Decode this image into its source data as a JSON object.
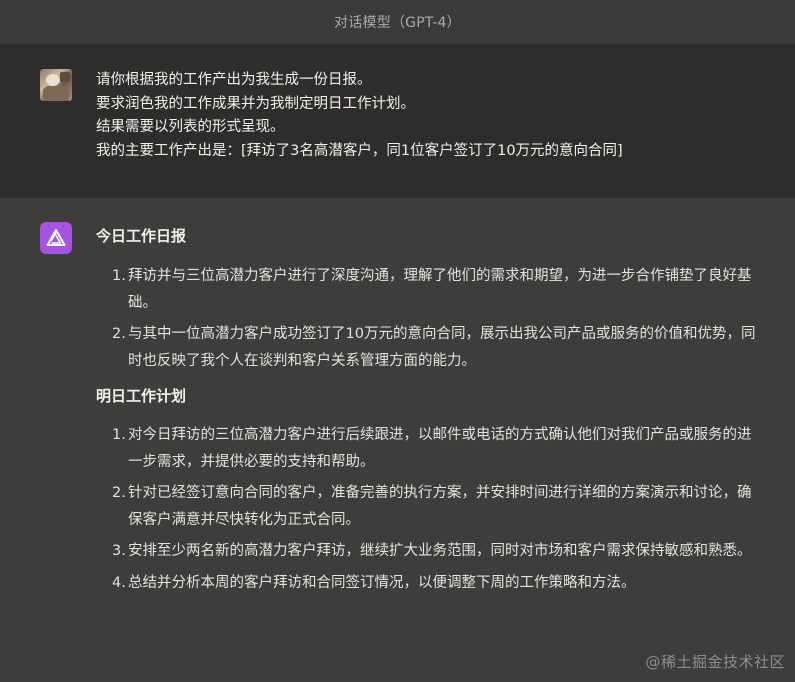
{
  "header": {
    "title": "对话模型（GPT-4）"
  },
  "user_message": {
    "avatar": "user-avatar-photo",
    "lines": [
      "请你根据我的工作产出为我生成一份日报。",
      "要求润色我的工作成果并为我制定明日工作计划。",
      "结果需要以列表的形式呈现。",
      "我的主要工作产出是：[拜访了3名高潜客户，同1位客户签订了10万元的意向合同]"
    ]
  },
  "assistant_message": {
    "avatar": "assistant-logo-icon",
    "avatar_color": "#a653e0",
    "sections": [
      {
        "title": "今日工作日报",
        "items": [
          {
            "num": "1.",
            "text": "拜访并与三位高潜力客户进行了深度沟通，理解了他们的需求和期望，为进一步合作铺垫了良好基础。"
          },
          {
            "num": "2.",
            "text": "与其中一位高潜力客户成功签订了10万元的意向合同，展示出我公司产品或服务的价值和优势，同时也反映了我个人在谈判和客户关系管理方面的能力。"
          }
        ]
      },
      {
        "title": "明日工作计划",
        "items": [
          {
            "num": "1.",
            "text": "对今日拜访的三位高潜力客户进行后续跟进，以邮件或电话的方式确认他们对我们产品或服务的进一步需求，并提供必要的支持和帮助。"
          },
          {
            "num": "2.",
            "text": "针对已经签订意向合同的客户，准备完善的执行方案，并安排时间进行详细的方案演示和讨论，确保客户满意并尽快转化为正式合同。"
          },
          {
            "num": "3.",
            "text": "安排至少两名新的高潜力客户拜访，继续扩大业务范围，同时对市场和客户需求保持敏感和熟悉。"
          },
          {
            "num": "4.",
            "text": "总结并分析本周的客户拜访和合同签订情况，以便调整下周的工作策略和方法。"
          }
        ]
      }
    ]
  },
  "watermark": "@稀土掘金技术社区"
}
